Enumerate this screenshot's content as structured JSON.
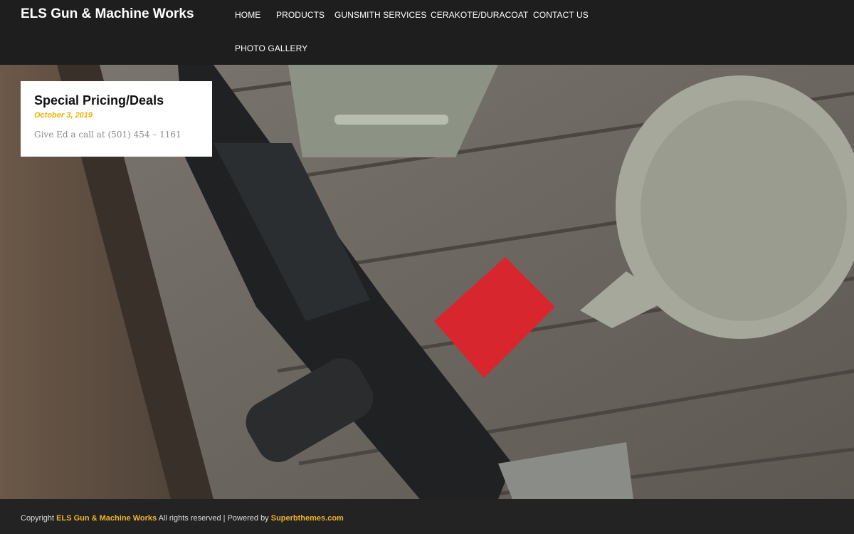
{
  "site": {
    "title": "ELS Gun & Machine Works"
  },
  "nav": {
    "items": [
      {
        "label": "HOME"
      },
      {
        "label": "PRODUCTS"
      },
      {
        "label": "GUNSMITH SERVICES"
      },
      {
        "label": "CERAKOTE/DURACOAT"
      },
      {
        "label": "CONTACT US"
      },
      {
        "label": "PHOTO GALLERY"
      }
    ]
  },
  "post": {
    "title": "Special Pricing/Deals",
    "date": "October 3, 2019",
    "excerpt": "Give Ed a call at (501) 454 – 1161"
  },
  "footer": {
    "copyright_prefix": "Copyright",
    "site_link": "ELS Gun & Machine Works",
    "rights_text": "All rights reserved | Powered by",
    "theme_link": "Superbthemes.com"
  },
  "colors": {
    "header_bg": "#1e1e1e",
    "accent": "#f0b429",
    "date_accent": "#e8b300",
    "footer_bg": "#232323"
  }
}
